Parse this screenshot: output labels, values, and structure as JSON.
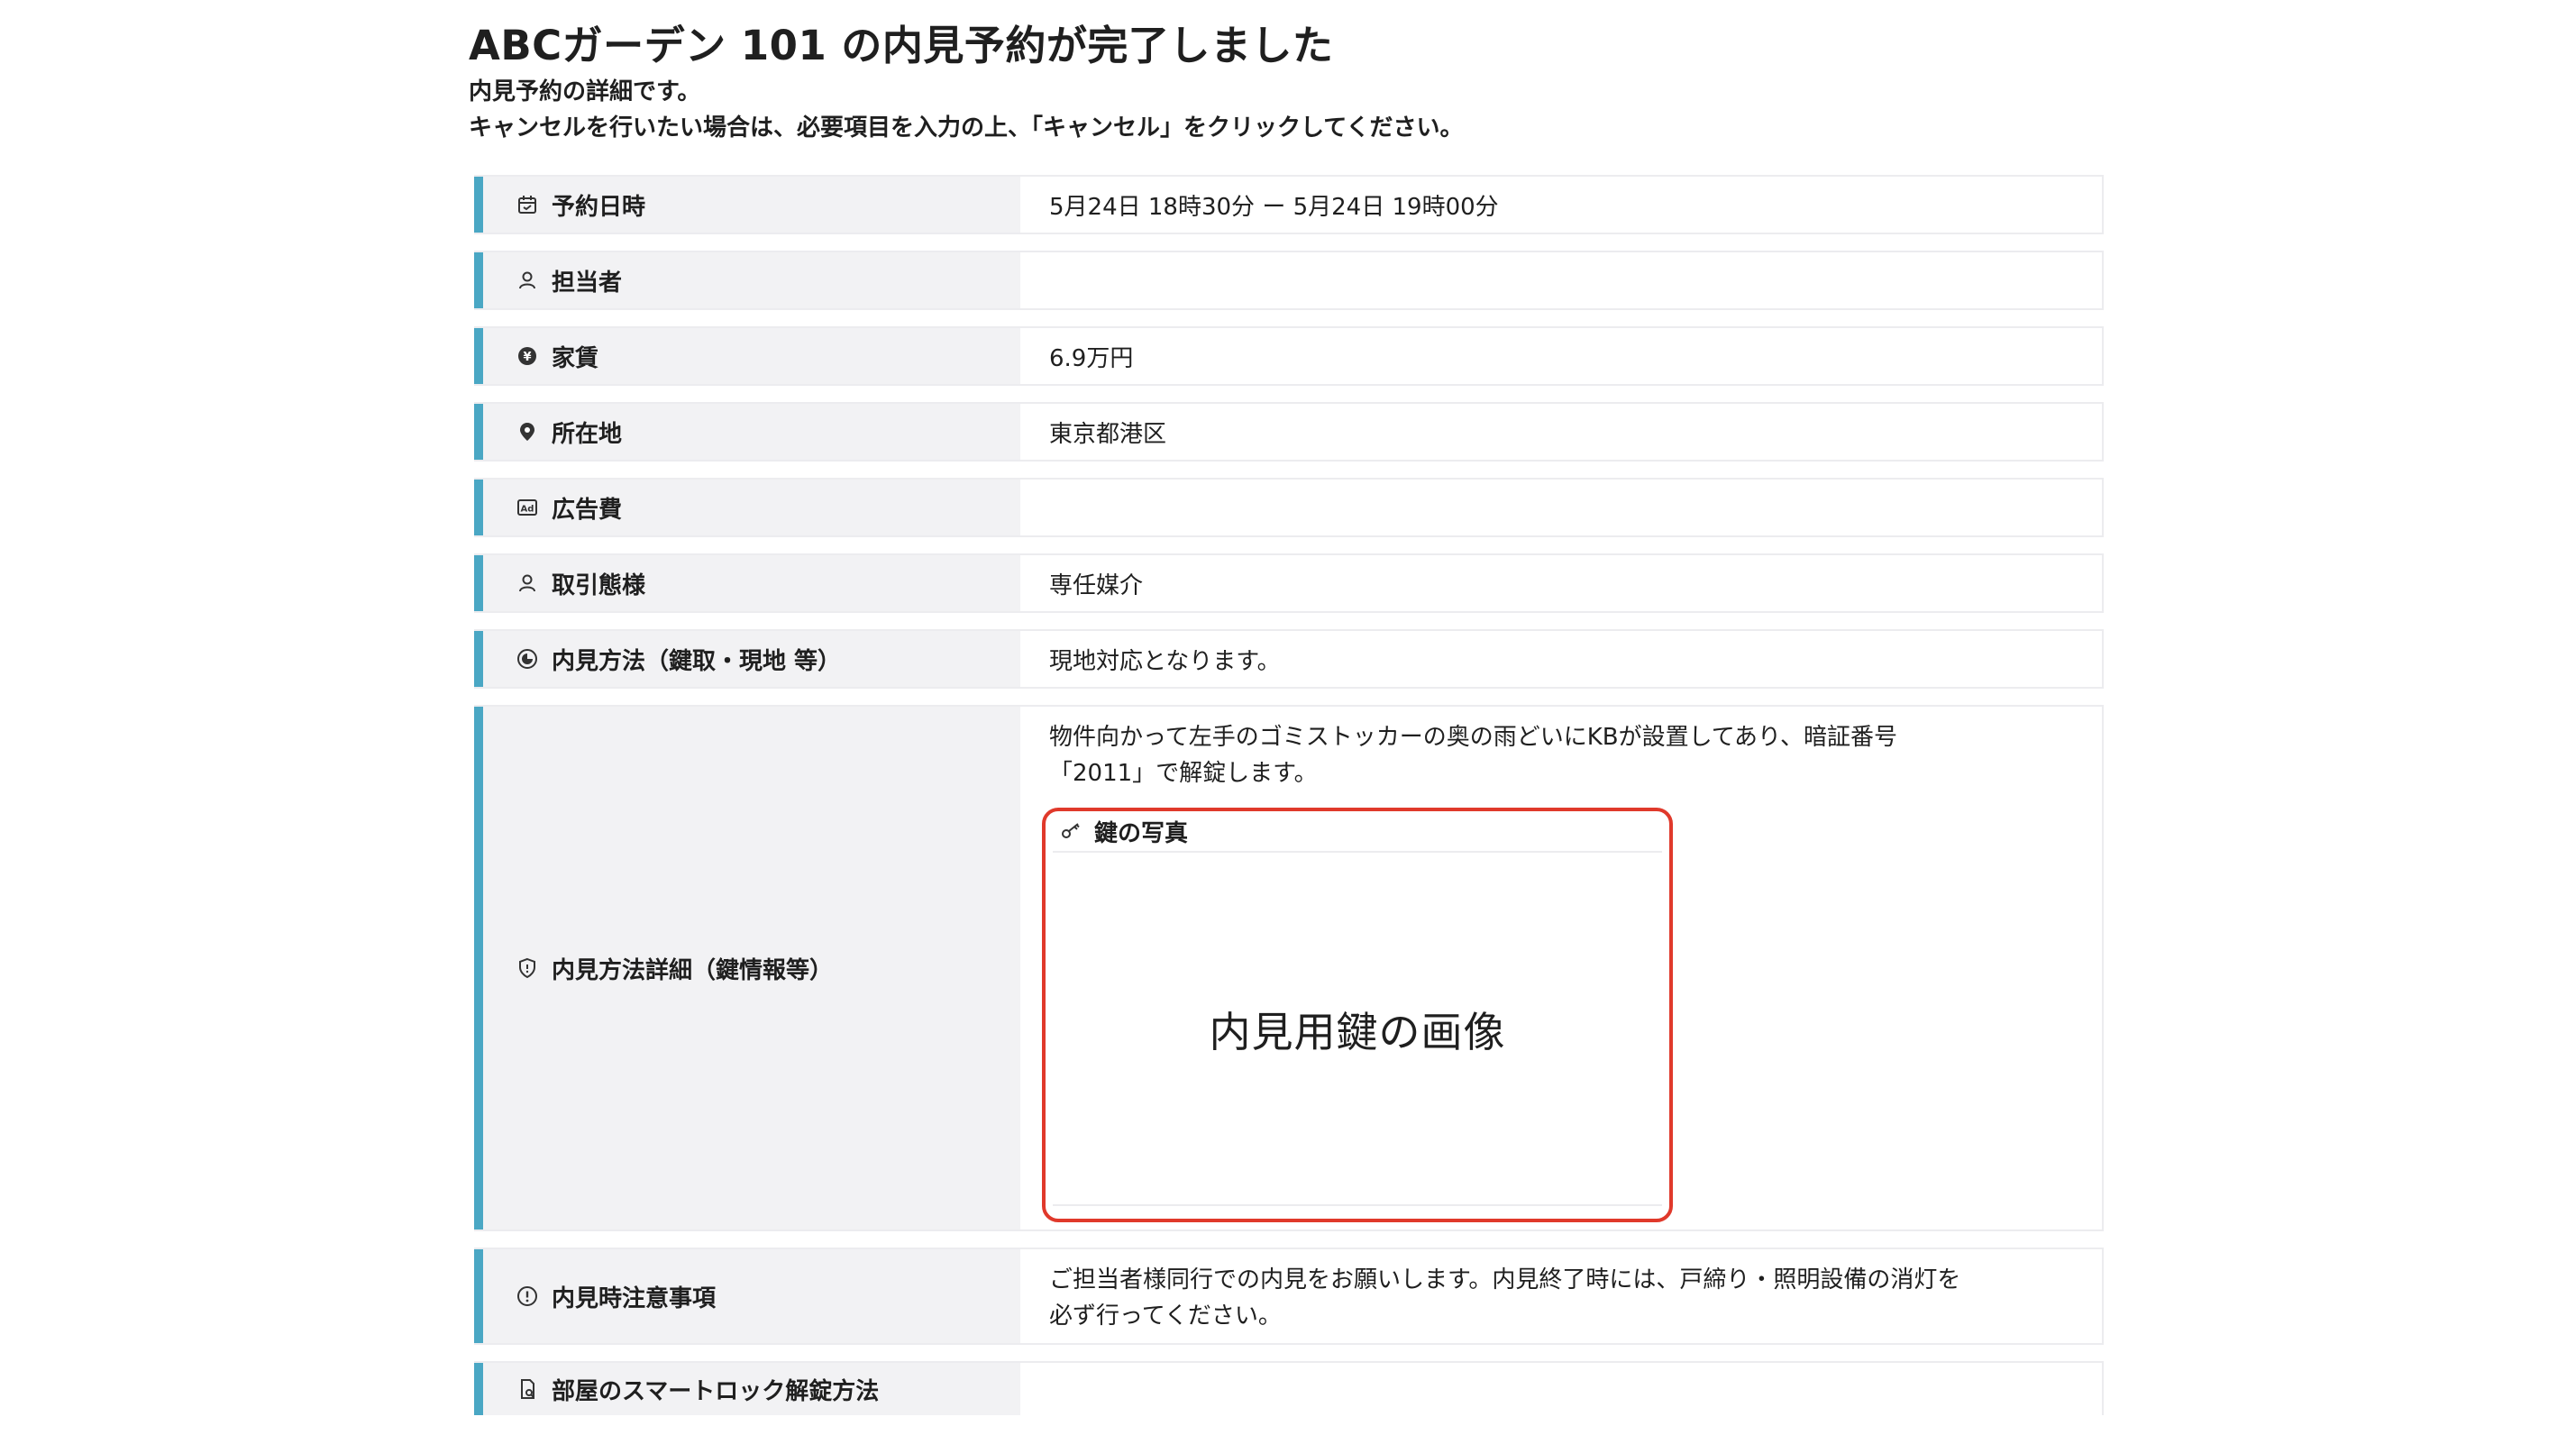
{
  "header": {
    "title": "ABCガーデン 101 の内見予約が完了しました",
    "intro_line1": "内見予約の詳細です。",
    "intro_line2": "キャンセルを行いたい場合は、必要項目を入力の上、「キャンセル」をクリックしてください。"
  },
  "rows": {
    "datetime": {
      "label": "予約日時",
      "value": "5月24日 18時30分 ー 5月24日 19時00分",
      "icon": "calendar-icon"
    },
    "staff": {
      "label": "担当者",
      "value": "",
      "icon": "person-icon"
    },
    "rent": {
      "label": "家賃",
      "value": "6.9万円",
      "icon": "yen-icon"
    },
    "address": {
      "label": "所在地",
      "value": "東京都港区",
      "icon": "location-pin-icon"
    },
    "ad_fee": {
      "label": "広告費",
      "value": "",
      "icon": "ad-icon"
    },
    "transaction": {
      "label": "取引態様",
      "value": "専任媒介",
      "icon": "person-icon"
    },
    "viewing_method": {
      "label": "内見方法（鍵取・現地 等）",
      "value": "現地対応となります。",
      "icon": "compass-icon"
    },
    "viewing_detail": {
      "label": "内見方法詳細（鍵情報等）",
      "icon": "shield-icon",
      "text_line1": "物件向かって左手のゴミストッカーの奥の雨どいにKBが設置してあり、暗証番号",
      "text_line2": "「2011」で解錠します。",
      "key_photo_title": "鍵の写真",
      "key_photo_placeholder": "内見用鍵の画像"
    },
    "notes": {
      "label": "内見時注意事項",
      "icon": "info-circle-icon",
      "value_line1": "ご担当者様同行での内見をお願いします。内見終了時には、戸締り・照明設備の消灯を",
      "value_line2": "必ず行ってください。"
    },
    "smart_lock": {
      "label": "部屋のスマートロック解錠方法",
      "value": "",
      "icon": "smartlock-icon"
    }
  },
  "colors": {
    "accent_bar": "#4aa7c4",
    "label_bg": "#f2f2f4",
    "highlight_border": "#e0392b"
  }
}
